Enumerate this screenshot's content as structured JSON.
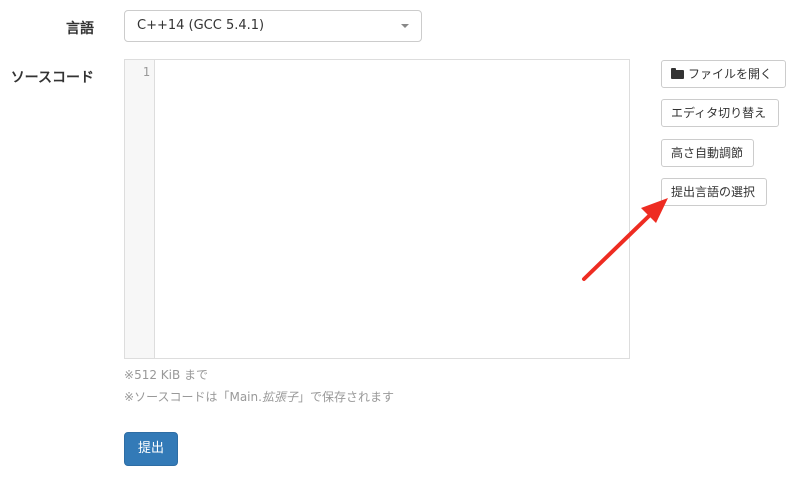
{
  "form": {
    "language_label": "言語",
    "language_value": "C++14 (GCC 5.4.1)",
    "source_label": "ソースコード"
  },
  "editor": {
    "line_number": "1"
  },
  "buttons": {
    "open_file": "ファイルを開く",
    "toggle_editor": "エディタ切り替え",
    "auto_height": "高さ自動調節",
    "select_language": "提出言語の選択",
    "submit": "提出"
  },
  "notes": {
    "size_limit": "512 KiB まで",
    "save_prefix": "ソースコードは「Main.",
    "save_ext": "拡張子",
    "save_suffix": "」で保存されます",
    "mark": "※"
  },
  "icons": {
    "open_file": "folder-open-icon",
    "dropdown": "caret-down-icon",
    "annotation": "red-arrow-icon"
  },
  "colors": {
    "primary": "#337ab7",
    "annotation_arrow": "#ee2c22"
  }
}
